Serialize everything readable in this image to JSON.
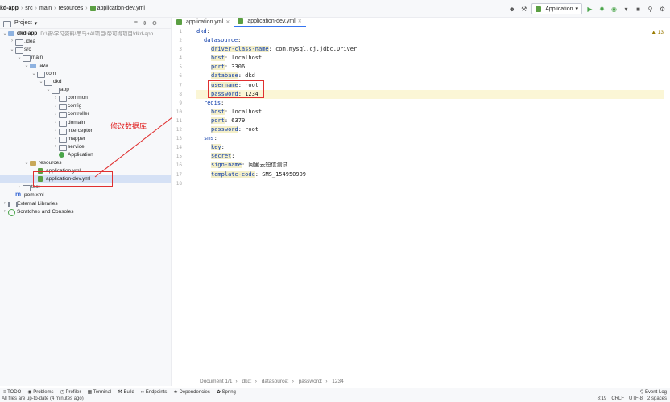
{
  "breadcrumbs": [
    "kd-app",
    "src",
    "main",
    "resources",
    "application-dev.yml"
  ],
  "toolbar": {
    "run_config": "Application"
  },
  "project_panel": {
    "title": "Project",
    "tree": [
      {
        "label": "dkd-app",
        "hint": "D:\\新\\学习资料\\黑马+AI项目\\帝可得项目\\dkd-app",
        "depth": 0,
        "icon": "folder-blue",
        "chev": "v",
        "bold": true
      },
      {
        "label": ".idea",
        "depth": 1,
        "icon": "folder",
        "chev": ">"
      },
      {
        "label": "src",
        "depth": 1,
        "icon": "folder",
        "chev": "v"
      },
      {
        "label": "main",
        "depth": 2,
        "icon": "folder",
        "chev": "v"
      },
      {
        "label": "java",
        "depth": 3,
        "icon": "folder-blue",
        "chev": "v"
      },
      {
        "label": "com",
        "depth": 4,
        "icon": "folder",
        "chev": "v"
      },
      {
        "label": "dkd",
        "depth": 5,
        "icon": "folder",
        "chev": "v"
      },
      {
        "label": "app",
        "depth": 6,
        "icon": "folder",
        "chev": "v"
      },
      {
        "label": "common",
        "depth": 7,
        "icon": "folder",
        "chev": ">"
      },
      {
        "label": "config",
        "depth": 7,
        "icon": "folder",
        "chev": ">"
      },
      {
        "label": "controller",
        "depth": 7,
        "icon": "folder",
        "chev": ">"
      },
      {
        "label": "domain",
        "depth": 7,
        "icon": "folder",
        "chev": ">"
      },
      {
        "label": "interceptor",
        "depth": 7,
        "icon": "folder",
        "chev": ">"
      },
      {
        "label": "mapper",
        "depth": 7,
        "icon": "folder",
        "chev": ">"
      },
      {
        "label": "service",
        "depth": 7,
        "icon": "folder",
        "chev": ">"
      },
      {
        "label": "Application",
        "depth": 7,
        "icon": "java",
        "chev": ""
      },
      {
        "label": "resources",
        "depth": 3,
        "icon": "folder-res",
        "chev": "v"
      },
      {
        "label": "application.yml",
        "depth": 4,
        "icon": "yml",
        "chev": ""
      },
      {
        "label": "application-dev.yml",
        "depth": 4,
        "icon": "yml",
        "chev": "",
        "selected": true
      },
      {
        "label": "test",
        "depth": 2,
        "icon": "folder",
        "chev": ">"
      },
      {
        "label": "pom.xml",
        "depth": 1,
        "icon": "xml",
        "chev": ""
      },
      {
        "label": "External Libraries",
        "depth": 0,
        "icon": "lib",
        "chev": ">"
      },
      {
        "label": "Scratches and Consoles",
        "depth": 0,
        "icon": "scratch",
        "chev": ">"
      }
    ]
  },
  "annotation": {
    "text": "修改数据库"
  },
  "tabs": [
    {
      "label": "application.yml",
      "active": false
    },
    {
      "label": "application-dev.yml",
      "active": true
    }
  ],
  "editor": {
    "warning": "▲ 13",
    "lines": [
      {
        "indent": 0,
        "key": "dkd",
        "value": ""
      },
      {
        "indent": 1,
        "key": "datasource",
        "value": ""
      },
      {
        "indent": 2,
        "key": "driver-class-name",
        "value": "com.mysql.cj.jdbc.Driver"
      },
      {
        "indent": 2,
        "key": "host",
        "value": "localhost"
      },
      {
        "indent": 2,
        "key": "port",
        "value": "3306"
      },
      {
        "indent": 2,
        "key": "database",
        "value": "dkd"
      },
      {
        "indent": 2,
        "key": "username",
        "value": "root"
      },
      {
        "indent": 2,
        "key": "password",
        "value": "1234",
        "current": true
      },
      {
        "indent": 1,
        "key": "redis",
        "value": ""
      },
      {
        "indent": 2,
        "key": "host",
        "value": "localhost"
      },
      {
        "indent": 2,
        "key": "port",
        "value": "6379"
      },
      {
        "indent": 2,
        "key": "password",
        "value": "root"
      },
      {
        "indent": 1,
        "key": "sms",
        "value": ""
      },
      {
        "indent": 2,
        "key": "key",
        "value": ""
      },
      {
        "indent": 2,
        "key": "secret",
        "value": ""
      },
      {
        "indent": 2,
        "key": "sign-name",
        "value": "阿里云短信测试"
      },
      {
        "indent": 2,
        "key": "template-code",
        "value": "SMS_154950909"
      },
      {
        "indent": 0,
        "key": "",
        "value": ""
      }
    ],
    "breadcrumb": [
      "Document 1/1",
      "dkd:",
      "datasource:",
      "password:",
      "1234"
    ]
  },
  "tool_windows": [
    "TODO",
    "Problems",
    "Profiler",
    "Terminal",
    "Build",
    "Endpoints",
    "Dependencies",
    "Spring"
  ],
  "event_log": "Event Log",
  "status": {
    "message": "All files are up-to-date (4 minutes ago)",
    "position": "8:19",
    "line_sep": "CRLF",
    "encoding": "UTF-8",
    "indent": "2 spaces"
  }
}
